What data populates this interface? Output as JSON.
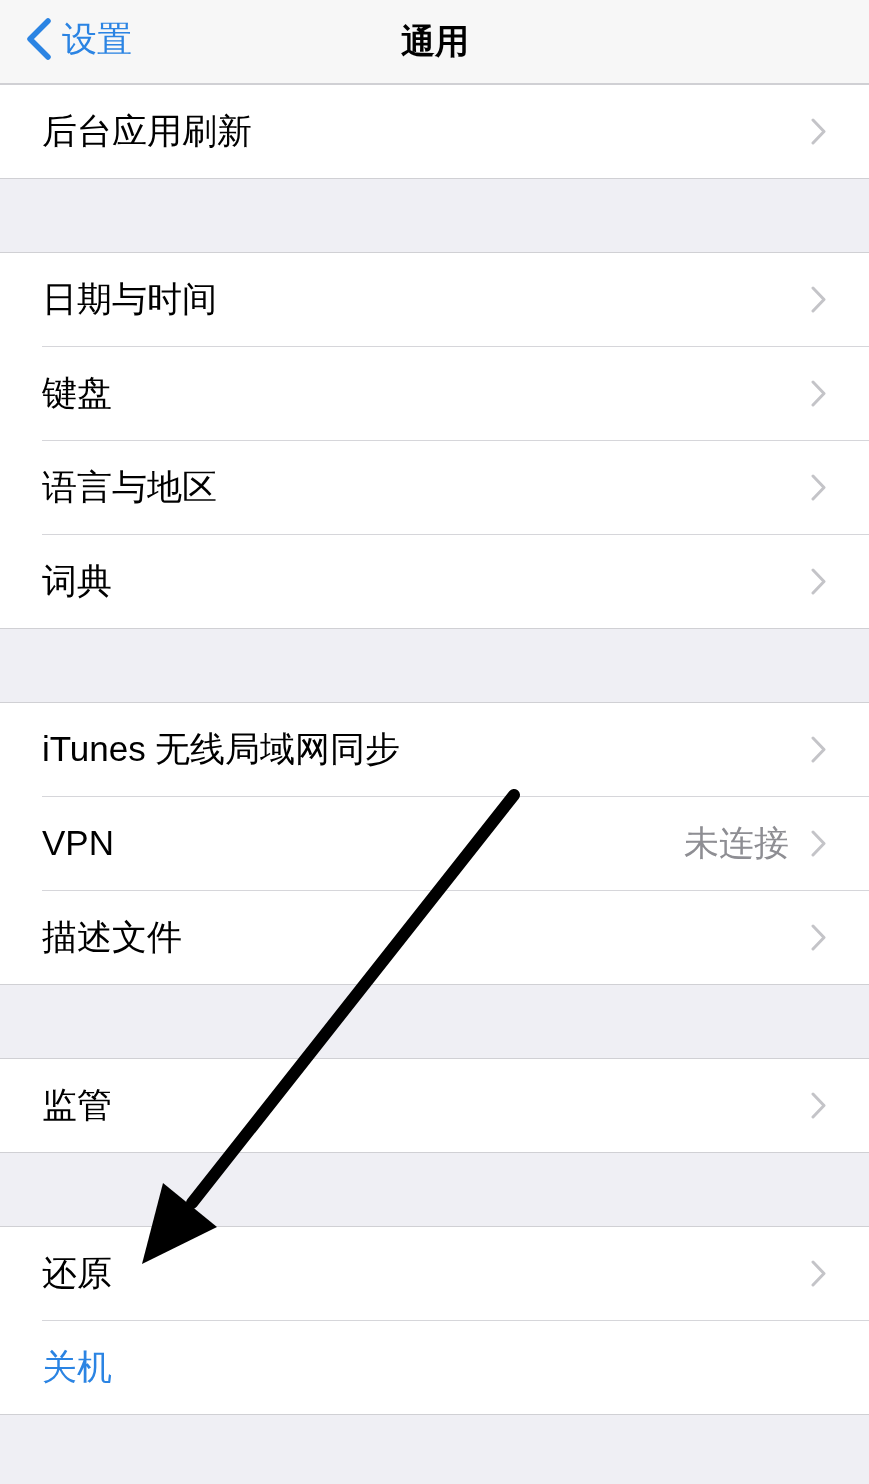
{
  "nav_bar": {
    "back_label": "设置",
    "title": "通用"
  },
  "sections": [
    {
      "rows": [
        {
          "kind": "link",
          "label": "后台应用刷新"
        }
      ]
    },
    {
      "rows": [
        {
          "kind": "link",
          "label": "日期与时间"
        },
        {
          "kind": "link",
          "label": "键盘"
        },
        {
          "kind": "link",
          "label": "语言与地区"
        },
        {
          "kind": "link",
          "label": "词典"
        }
      ]
    },
    {
      "rows": [
        {
          "kind": "link",
          "label": "iTunes 无线局域网同步"
        },
        {
          "kind": "link",
          "label": "VPN",
          "value": "未连接"
        },
        {
          "kind": "link",
          "label": "描述文件"
        }
      ]
    },
    {
      "rows": [
        {
          "kind": "link",
          "label": "监管"
        }
      ]
    },
    {
      "rows": [
        {
          "kind": "link",
          "label": "还原"
        },
        {
          "kind": "action",
          "label": "关机"
        }
      ]
    }
  ]
}
